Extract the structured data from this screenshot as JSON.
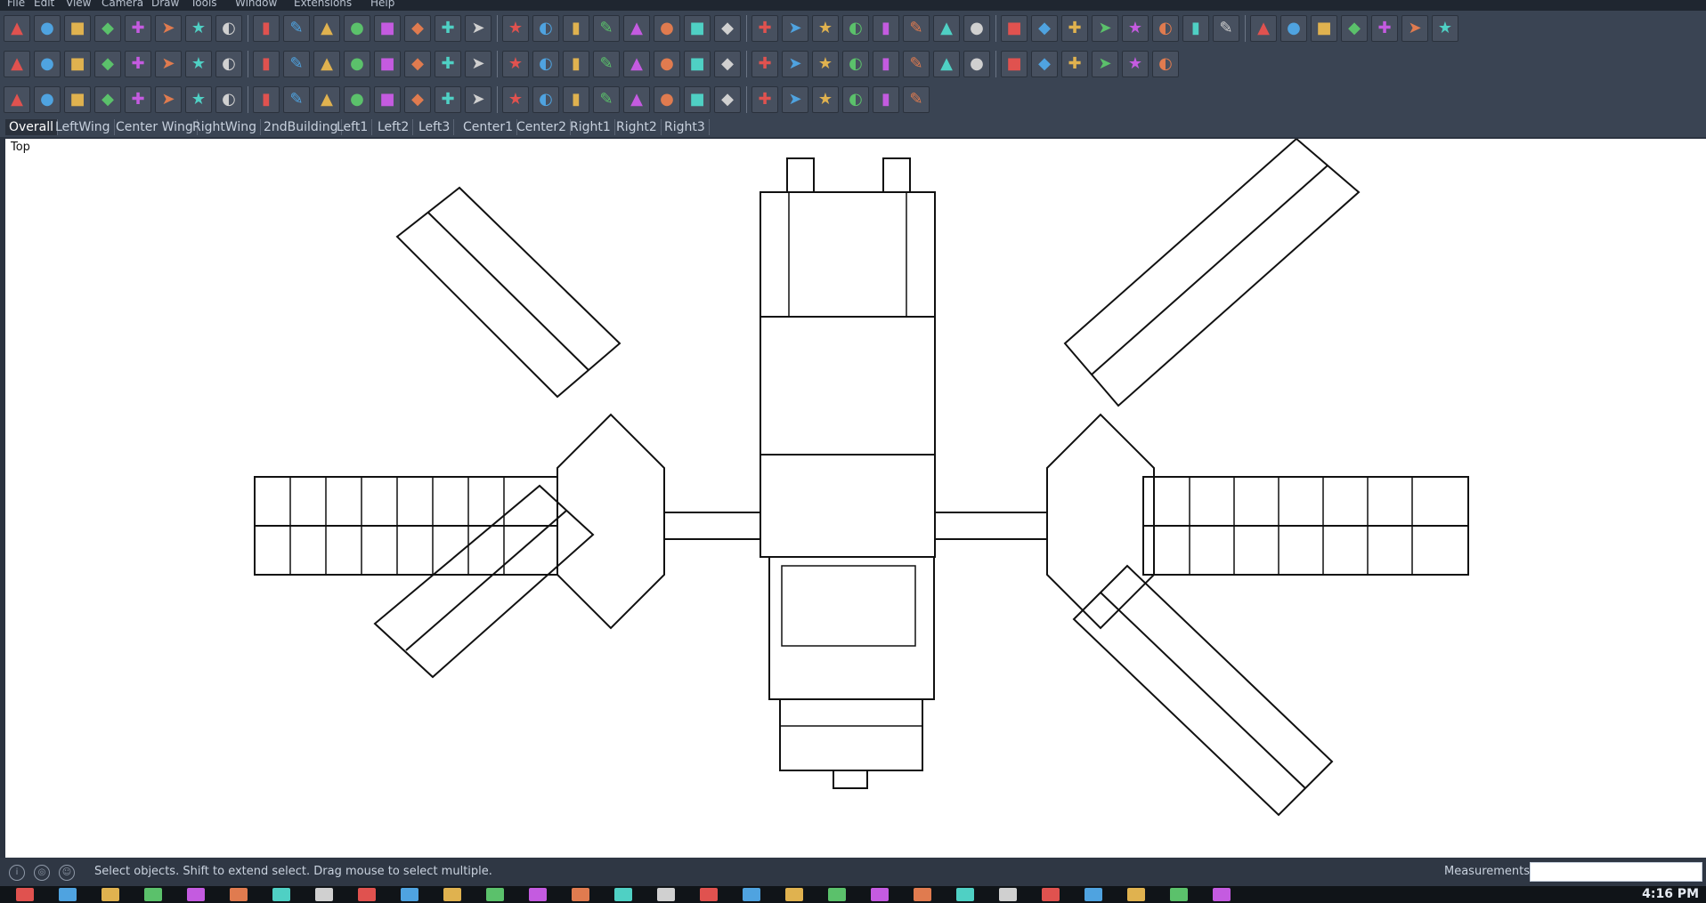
{
  "menu": {
    "items": [
      "File",
      "Edit",
      "View",
      "Camera",
      "Draw",
      "Tools",
      "Window",
      "Extensions",
      "Help"
    ]
  },
  "toolbar": {
    "row1": [
      "select-arrow-icon",
      "eraser-icon",
      "line-icon",
      "arc-icon",
      "rectangle-icon",
      "push-pull-icon",
      "follow-me-icon",
      "move-icon",
      "rotate-icon",
      "scale-icon",
      "tape-measure-icon",
      "text-icon",
      "paint-bucket-icon",
      "orbit-icon",
      "pan-icon",
      "zoom-icon",
      "zoom-extents-icon",
      "previous-view-icon",
      "next-view-icon",
      "photo-textures-icon",
      "component-icon",
      "iso-view-icon",
      "top-view-icon",
      "front-view-icon",
      "right-view-icon",
      "back-view-icon",
      "left-view-icon",
      "xray-icon",
      "back-edges-icon",
      "wireframe-icon",
      "hidden-line-icon",
      "shaded-icon",
      "shaded-textures-icon",
      "monochrome-icon",
      "section-plane-icon",
      "section-display-icon",
      "section-cut-icon",
      "warehouse-icon",
      "extension-icon",
      "layout-icon",
      "styles-icon",
      "shadows-icon",
      "fog-icon",
      "scissors-icon",
      "knife-icon",
      "camera-icon",
      "walk-icon"
    ],
    "row2": [
      "solid-union-icon",
      "solid-intersect-icon",
      "solid-trim-icon",
      "solid-split-icon",
      "solid-subtract-icon",
      "solid-outer-shell-icon",
      "sandbox-from-contours-icon",
      "sandbox-from-scratch-icon",
      "smoove-icon",
      "stamp-icon",
      "drape-icon",
      "add-detail-icon",
      "flip-edge-icon",
      "terrain-icon",
      "shape-bender-icon",
      "vertex-tools-icon",
      "push-up-icon",
      "push-down-icon",
      "extrude-icon",
      "offset-icon",
      "fillet-icon",
      "chamfer-icon",
      "hex-shape-icon",
      "pentagon-icon",
      "diamond-icon",
      "spiral-icon",
      "pencil-tool-icon",
      "mirror-icon",
      "component-stack-icon",
      "component-copy-icon",
      "component-group-icon",
      "dimension-icon",
      "protractor-icon",
      "axes-icon",
      "guide-icon",
      "cone-icon",
      "grid-dots-icon",
      "color-dots-icon"
    ],
    "row3": [
      "circle-icon",
      "plane-icon",
      "plane-alt-icon",
      "box-icon",
      "box-stack-icon",
      "curve-icon",
      "curve-alt-icon",
      "diamond-plane-icon",
      "diamond-alt-icon",
      "cube-white-icon",
      "cubes-icon",
      "curve-red-icon",
      "curve-red-alt-icon",
      "hammer-icon",
      "hash-box-icon",
      "ramp-icon",
      "slab-icon",
      "wall-icon",
      "blue-box-icon",
      "sphere-icon",
      "headphones-icon",
      "globe-icon",
      "magenta-line-icon",
      "loop-icon",
      "bezier-icon",
      "fan-icon",
      "curve-blue-icon",
      "wave-icon",
      "arc-dots-icon",
      "arc-rainbow-icon"
    ]
  },
  "tabs": [
    "Overall",
    "LeftWing",
    "Center Wing",
    "RightWing",
    "2ndBuilding",
    "Left1",
    "Left2",
    "Left3",
    "Center1",
    "Center2",
    "Right1",
    "Right2",
    "Right3"
  ],
  "active_tab": "Overall",
  "viewport": {
    "view_label": "Top",
    "accent": "#ffffff",
    "line_color": "#111111"
  },
  "status": {
    "message": "Select objects. Shift to extend select. Drag mouse to select multiple.",
    "icons": [
      "info-icon",
      "geo-icon",
      "user-icon"
    ],
    "measurements_label": "Measurements",
    "measurements_value": ""
  },
  "taskbar": {
    "clock": "4:16 PM",
    "apps": [
      "start-icon",
      "task-view-icon",
      "explorer-icon",
      "store-icon",
      "mail-icon",
      "word-icon",
      "excel-icon",
      "folder-icon",
      "settings-icon",
      "sketchup-icon",
      "acrobat-icon",
      "photoshop-icon",
      "media-icon",
      "chrome-icon",
      "camera-icon",
      "notes-icon",
      "maps-icon",
      "autocad-icon",
      "browser-icon",
      "cloud-icon",
      "camera-alt-icon",
      "people-icon",
      "terminal-icon",
      "edge-icon",
      "spotify-icon",
      "green-app-icon",
      "grammarly-icon",
      "tools-icon",
      "paint-icon"
    ]
  }
}
